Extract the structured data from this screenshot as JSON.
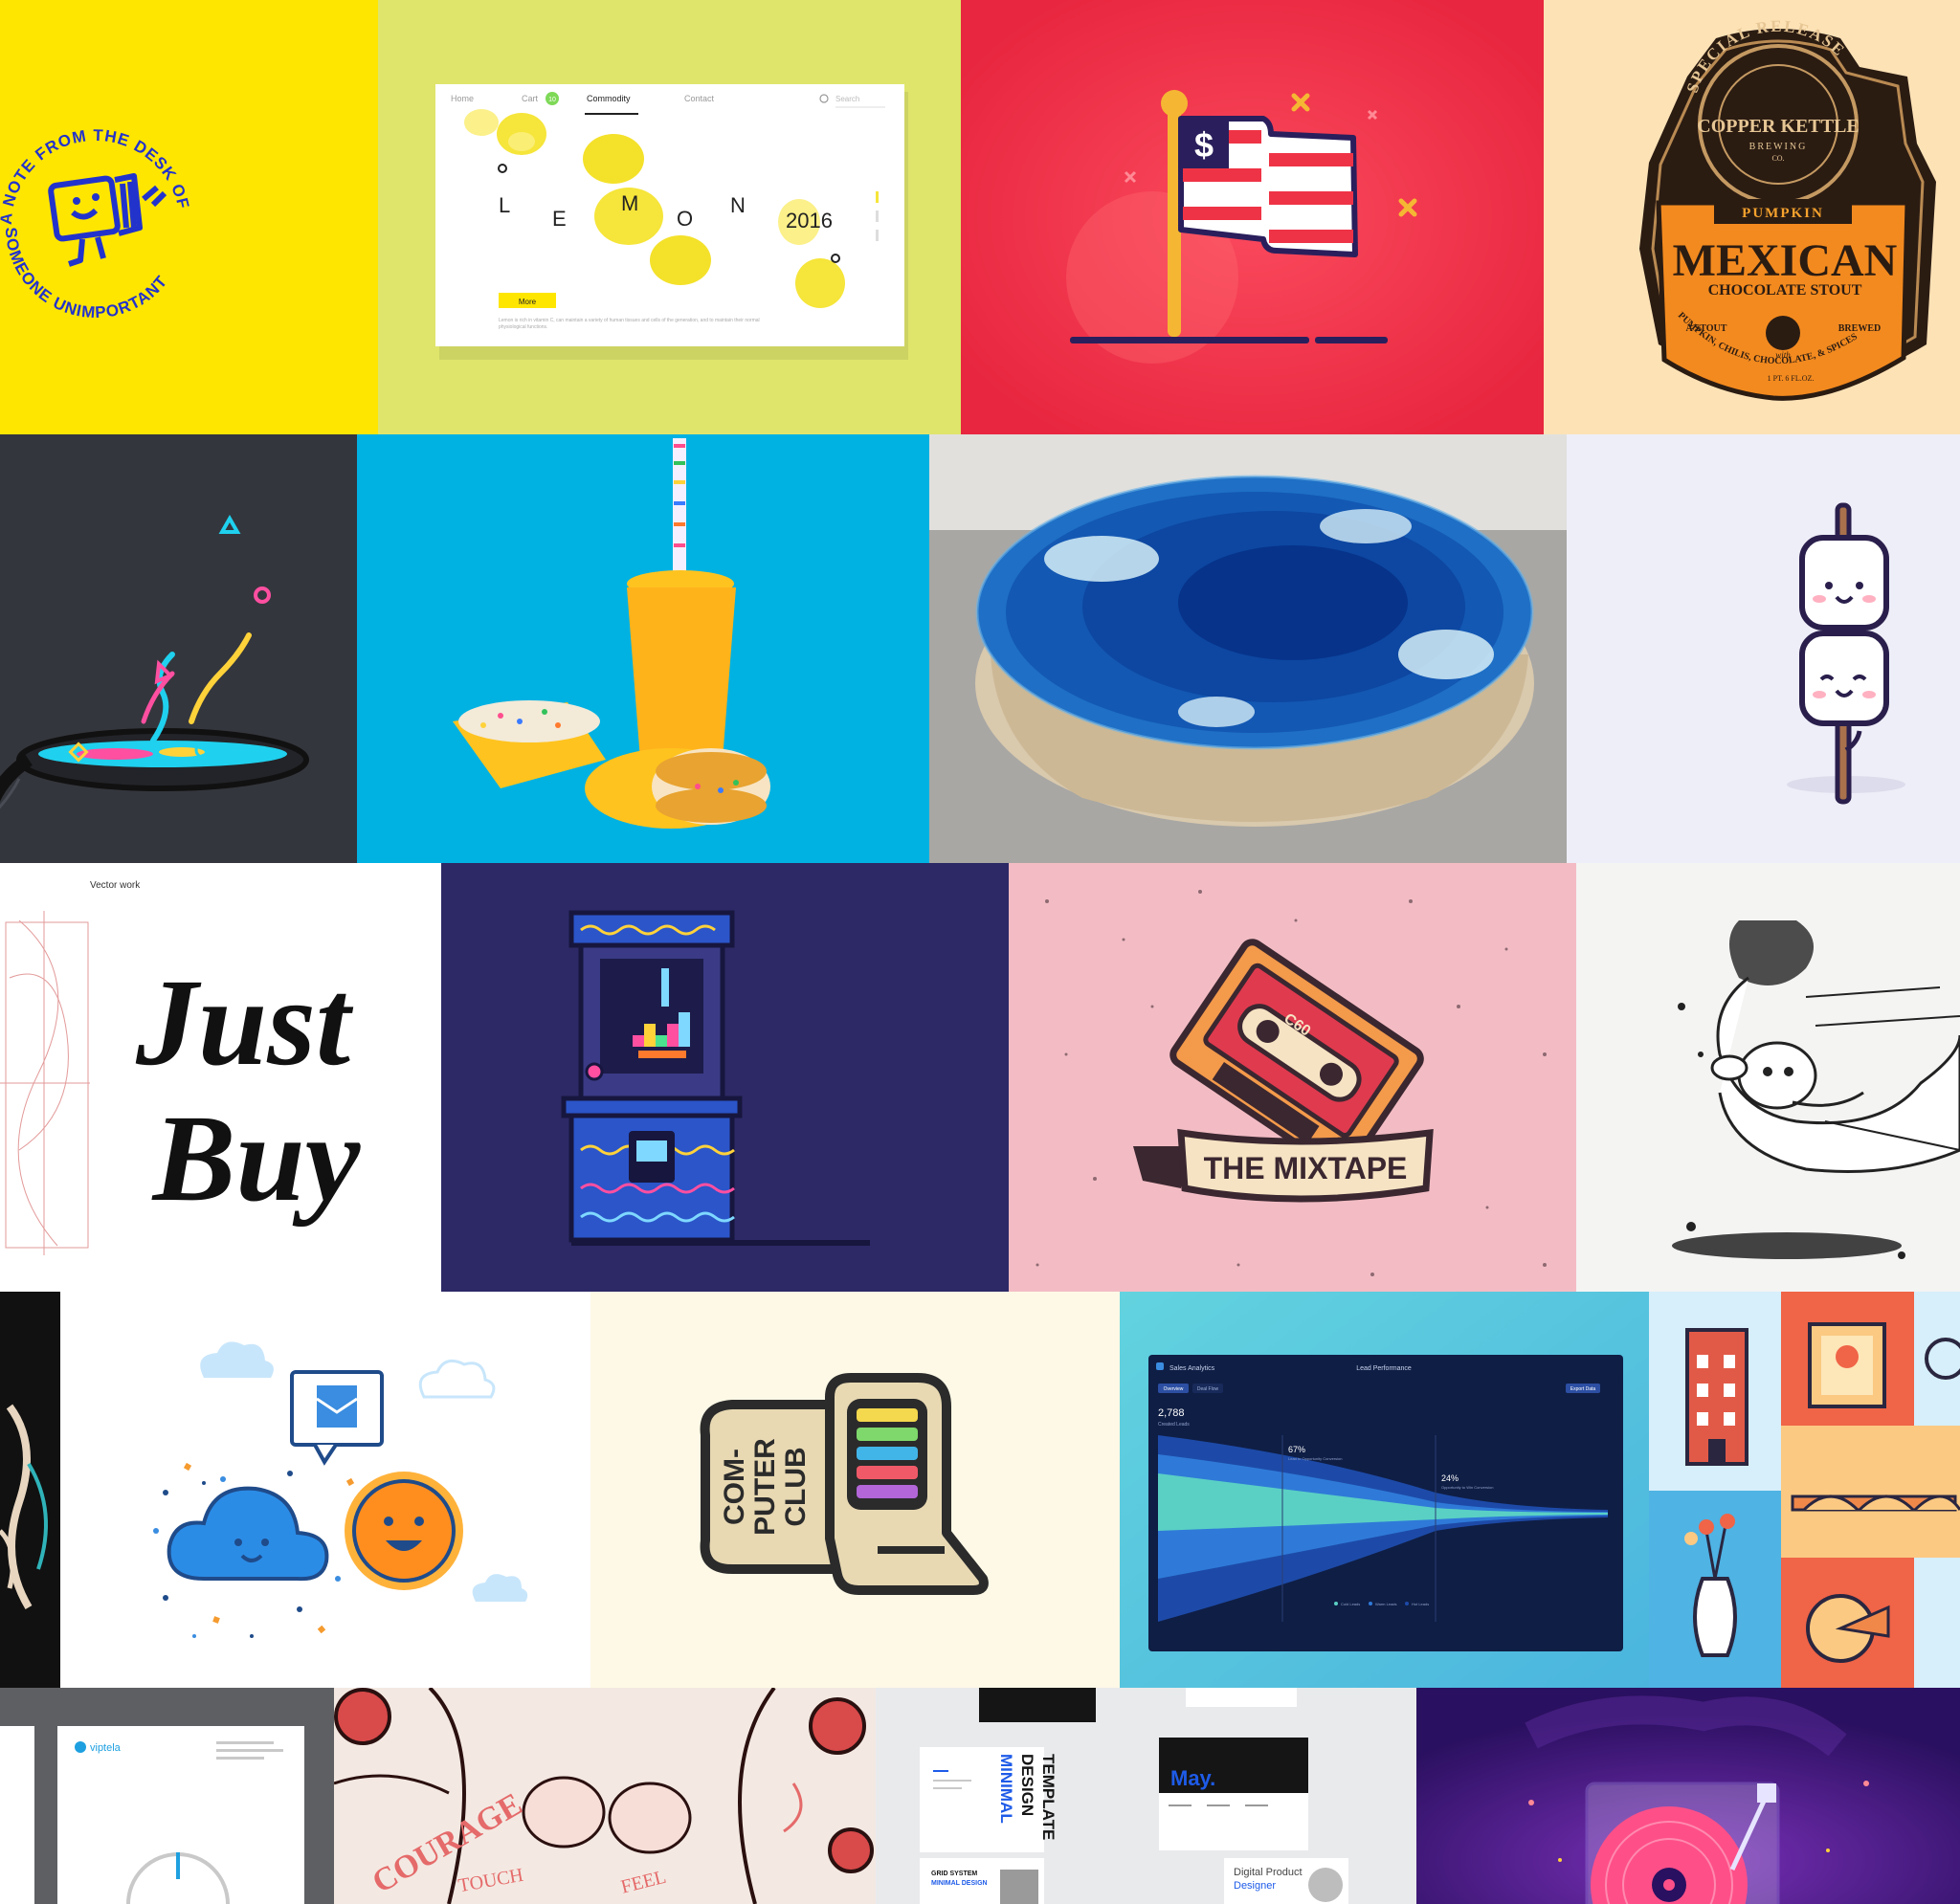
{
  "colors": {
    "yellow": "#ffe600",
    "lime": "#dfe56b",
    "red": "#f0344c",
    "peach": "#fde2b6",
    "charcoal": "#34363d",
    "sky": "#00b2e2",
    "concrete": "#c9c8c5",
    "lavender": "#eeeef8",
    "navy": "#2c2966",
    "pink": "#f3bcc4",
    "cream": "#fdf9e6",
    "teal": "#5ccfdc",
    "violet": "#3a1a6e"
  },
  "tiles": {
    "stamp": {
      "arc_top": "A NOTE FROM THE DESK OF",
      "arc_bottom": "SOMEONE UNIMPORTANT"
    },
    "lemon": {
      "nav": [
        "Home",
        "Cart",
        "Commodity",
        "Contact"
      ],
      "cart_count": "10",
      "search_placeholder": "Search",
      "letters": [
        "L",
        "E",
        "M",
        "O",
        "N"
      ],
      "year": "2016",
      "button": "More",
      "body": "Lemon is rich in vitamin C, can maintain a variety of human tissues and cells of the generation, and to maintain their normal physiological functions."
    },
    "flag": {
      "symbol": "$"
    },
    "beer": {
      "top_arc": "SPECIAL RELEASE",
      "brand_1": "COPPER KETTLE",
      "brand_2": "BREWING",
      "brand_3": "CO.",
      "ribbon": "PUMPKIN",
      "main": "MEXICAN",
      "sub": "CHOCOLATE STOUT",
      "left": "A STOUT",
      "mid": "with",
      "right": "BREWED",
      "arc_bottom": "PUMPKIN, CHILIS, CHOCOLATE, & SPICES",
      "volume": "1 PT. 6 FL.OZ."
    },
    "lettering": {
      "caption": "Vector work",
      "word_1": "Just",
      "word_2": "Buy"
    },
    "mixtape": {
      "banner": "THE MIXTAPE",
      "tape_label": "C60"
    },
    "computer_club": {
      "line_1": "COM-",
      "line_2": "PUTER",
      "line_3": "CLUB"
    },
    "dashboard": {
      "app_title": "Sales Analytics",
      "panel_title": "Lead Performance",
      "tab_1": "Overview",
      "tab_2": "Deal Flow",
      "button": "Export Data",
      "total": "2,788",
      "total_label": "Created Leads",
      "stage_1_value": "67%",
      "stage_1_label": "Lead to Opportunity Conversion",
      "stage_2_value": "24%",
      "stage_2_label": "Opportunity to Win Conversion",
      "legend": [
        "Cold Leads",
        "Warm Leads",
        "Hot Leads"
      ]
    },
    "brochure": {
      "brand": "viptela"
    },
    "tattoo": {
      "word_1": "COURAGE",
      "word_2": "TOUCH",
      "word_3": "FEEL"
    },
    "templates": {
      "title_1": "MINIMAL",
      "title_2": "DESIGN",
      "title_3": "TEMPLATE",
      "month": "May.",
      "grid_1": "GRID SYSTEM",
      "grid_2": "MINIMAL DESIGN",
      "role_1": "Digital Product",
      "role_2": "Designer"
    }
  }
}
